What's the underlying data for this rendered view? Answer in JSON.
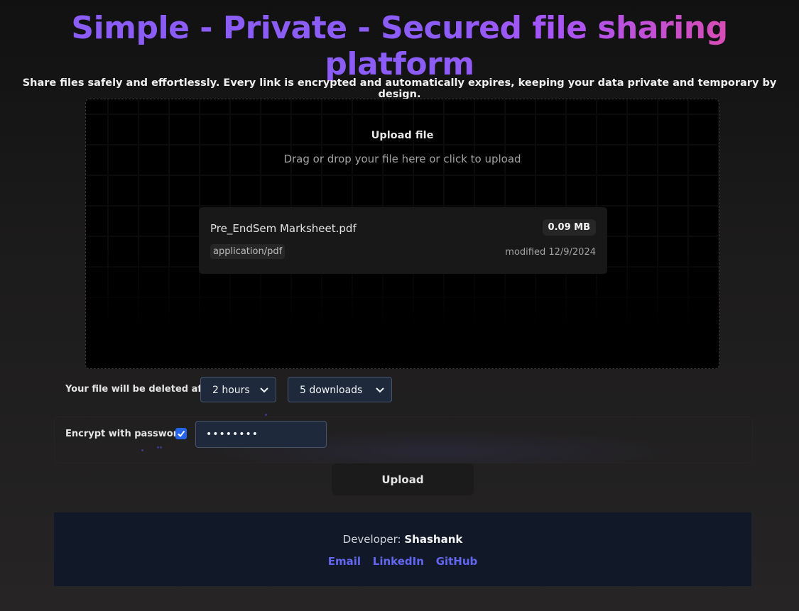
{
  "header": {
    "title": "Simple - Private - Secured file sharing platform",
    "subtitle": "Share files safely and effortlessly. Every link is encrypted and automatically expires, keeping your data private and temporary by design."
  },
  "dropzone": {
    "title": "Upload file",
    "hint": "Drag or drop your file here or click to upload"
  },
  "file": {
    "name": "Pre_EndSem Marksheet.pdf",
    "size": "0.09 MB",
    "type": "application/pdf",
    "modified": "modified 12/9/2024"
  },
  "expiry": {
    "label": "Your file will be deleted after",
    "time_value": "2 hours",
    "downloads_value": "5 downloads"
  },
  "encryption": {
    "label": "Encrypt with password",
    "checked": true,
    "password_value": "••••••••"
  },
  "actions": {
    "upload_label": "Upload"
  },
  "footer": {
    "developer_prefix": "Developer: ",
    "developer_name": "Shashank",
    "links": [
      "Email",
      "LinkedIn",
      "GitHub"
    ]
  },
  "colors": {
    "title_gradient_start": "#8b5cf6",
    "title_gradient_end": "#ec4899",
    "link": "#6366f1",
    "checkbox": "#2563eb",
    "footer_bg": "#111827"
  },
  "icons": {
    "select_chevron": "chevron-down-icon",
    "checkbox_mark": "check-icon"
  }
}
